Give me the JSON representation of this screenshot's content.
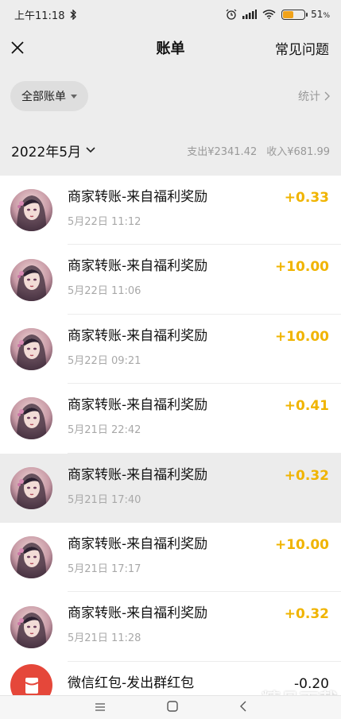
{
  "status": {
    "time": "上午11:18",
    "battery_percent": "51",
    "battery_level": 0.51
  },
  "nav": {
    "title": "账单",
    "help": "常见问题"
  },
  "filter": {
    "label": "全部账单",
    "stats": "统计"
  },
  "month": {
    "label": "2022年5月",
    "expense": "支出¥2341.42",
    "income": "收入¥681.99"
  },
  "transactions": [
    {
      "title": "商家转账-来自福利奖励",
      "time": "5月22日 11:12",
      "amount": "+0.33"
    },
    {
      "title": "商家转账-来自福利奖励",
      "time": "5月22日 11:06",
      "amount": "+10.00"
    },
    {
      "title": "商家转账-来自福利奖励",
      "time": "5月22日 09:21",
      "amount": "+10.00"
    },
    {
      "title": "商家转账-来自福利奖励",
      "time": "5月21日 22:42",
      "amount": "+0.41"
    },
    {
      "title": "商家转账-来自福利奖励",
      "time": "5月21日 17:40",
      "amount": "+0.32"
    },
    {
      "title": "商家转账-来自福利奖励",
      "time": "5月21日 17:17",
      "amount": "+10.00"
    },
    {
      "title": "商家转账-来自福利奖励",
      "time": "5月21日 11:28",
      "amount": "+0.32"
    },
    {
      "title": "微信红包-发出群红包",
      "time": "",
      "amount": "-0.20"
    }
  ],
  "watermark": "精品下载",
  "colors": {
    "income": "#f0b400",
    "background": "#ededed",
    "red_packet": "#e5473a"
  }
}
